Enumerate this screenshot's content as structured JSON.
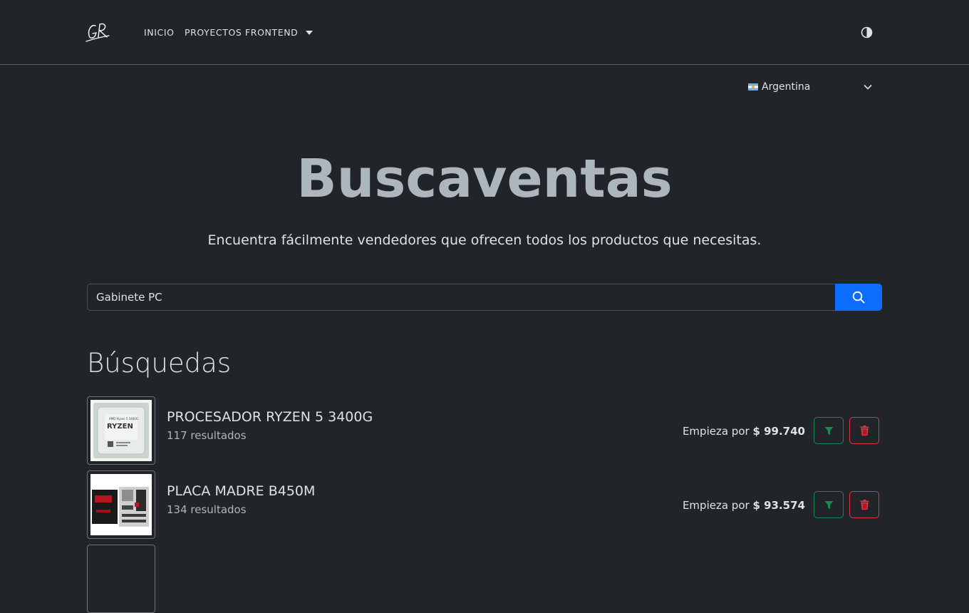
{
  "nav": {
    "logo_text": "GR",
    "inicio": "INICIO",
    "proyectos": "PROYECTOS FRONTEND",
    "theme_icon": "half-circle-icon"
  },
  "country": {
    "selected": "Argentina",
    "flag": "argentina-flag-icon"
  },
  "hero": {
    "title": "Buscaventas",
    "subtitle": "Encuentra fácilmente vendedores que ofrecen todos los productos que necesitas."
  },
  "search": {
    "value": "Gabinete PC",
    "button_icon": "search-icon"
  },
  "section": {
    "title": "Búsquedas"
  },
  "results": [
    {
      "title": "PROCESADOR RYZEN 5 3400G",
      "count": "117 resultados",
      "price_prefix": "Empieza por",
      "price": "$ 99.740",
      "image": "ryzen-processor-image"
    },
    {
      "title": "PLACA MADRE B450M",
      "count": "134 resultados",
      "price_prefix": "Empieza por",
      "price": "$ 93.574",
      "image": "motherboard-image"
    }
  ],
  "colors": {
    "background": "#212529",
    "primary": "#0d6efd",
    "success": "#198754",
    "danger": "#dc3545"
  }
}
